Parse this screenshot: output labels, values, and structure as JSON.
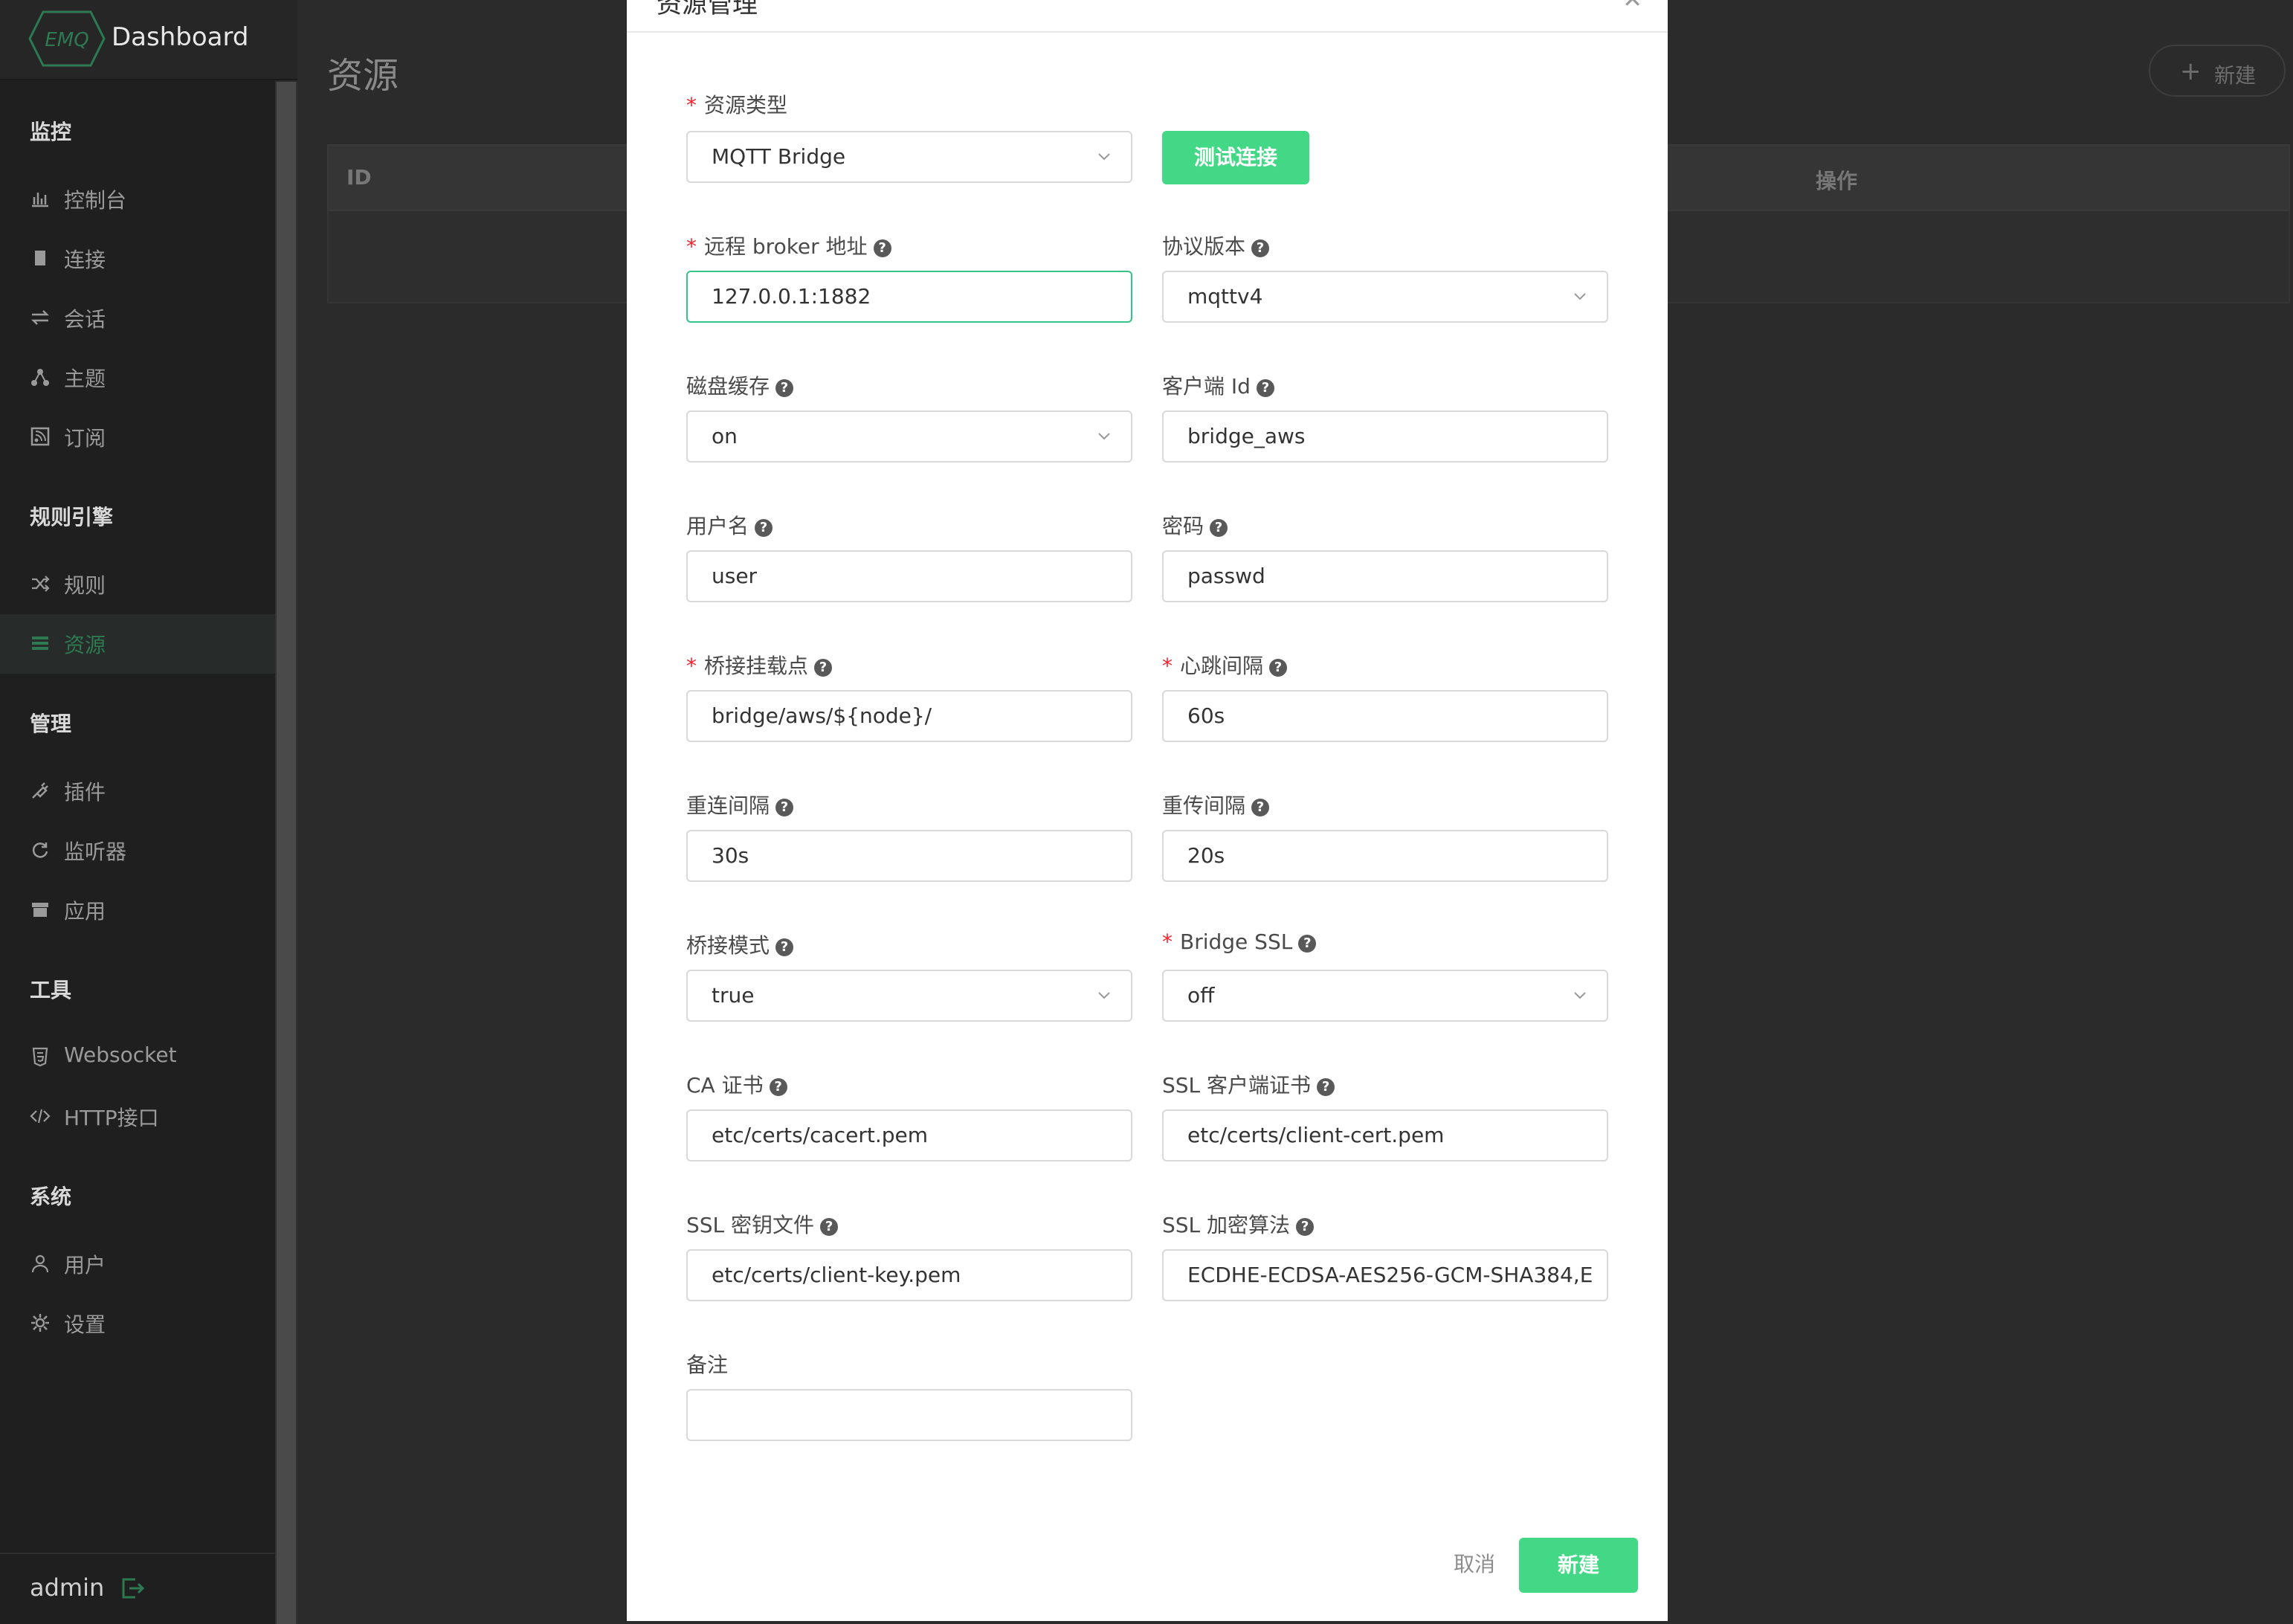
{
  "app": {
    "title": "Dashboard",
    "logo_text": "EMQ"
  },
  "sidebar": {
    "groups": [
      {
        "title": "监控",
        "items": [
          {
            "label": "控制台",
            "icon": "bar-chart-icon"
          },
          {
            "label": "连接",
            "icon": "document-icon"
          },
          {
            "label": "会话",
            "icon": "swap-icon"
          },
          {
            "label": "主题",
            "icon": "topic-icon"
          },
          {
            "label": "订阅",
            "icon": "rss-icon"
          }
        ]
      },
      {
        "title": "规则引擎",
        "items": [
          {
            "label": "规则",
            "icon": "shuffle-icon"
          },
          {
            "label": "资源",
            "icon": "list-icon",
            "active": true
          }
        ]
      },
      {
        "title": "管理",
        "items": [
          {
            "label": "插件",
            "icon": "plug-icon"
          },
          {
            "label": "监听器",
            "icon": "refresh-icon"
          },
          {
            "label": "应用",
            "icon": "archive-icon"
          }
        ]
      },
      {
        "title": "工具",
        "items": [
          {
            "label": "Websocket",
            "icon": "html5-icon"
          },
          {
            "label": "HTTP接口",
            "icon": "code-icon"
          }
        ]
      },
      {
        "title": "系统",
        "items": [
          {
            "label": "用户",
            "icon": "user-icon"
          },
          {
            "label": "设置",
            "icon": "gear-icon"
          }
        ]
      }
    ],
    "footer": {
      "user": "admin"
    }
  },
  "page": {
    "title": "资源",
    "new_button": "新建",
    "table_headers": {
      "id": "ID",
      "actions": "操作"
    }
  },
  "modal": {
    "title": "资源管理",
    "test_button": "测试连接",
    "cancel_button": "取消",
    "submit_button": "新建",
    "fields": {
      "resource_type": {
        "label": "资源类型",
        "value": "MQTT Bridge"
      },
      "broker_address": {
        "label": "远程 broker 地址",
        "value": "127.0.0.1:1882"
      },
      "protocol_version": {
        "label": "协议版本",
        "value": "mqttv4"
      },
      "disk_cache": {
        "label": "磁盘缓存",
        "value": "on"
      },
      "client_id": {
        "label": "客户端 Id",
        "value": "bridge_aws"
      },
      "username": {
        "label": "用户名",
        "value": "user"
      },
      "password": {
        "label": "密码",
        "value": "passwd"
      },
      "mountpoint": {
        "label": "桥接挂载点",
        "value": "bridge/aws/${node}/"
      },
      "keepalive": {
        "label": "心跳间隔",
        "value": "60s"
      },
      "reconnect_interval": {
        "label": "重连间隔",
        "value": "30s"
      },
      "retry_interval": {
        "label": "重传间隔",
        "value": "20s"
      },
      "bridge_mode": {
        "label": "桥接模式",
        "value": "true"
      },
      "bridge_ssl": {
        "label": "Bridge SSL",
        "value": "off"
      },
      "ca_cert": {
        "label": "CA 证书",
        "value": "etc/certs/cacert.pem"
      },
      "client_cert": {
        "label": "SSL 客户端证书",
        "value": "etc/certs/client-cert.pem"
      },
      "key_file": {
        "label": "SSL 密钥文件",
        "value": "etc/certs/client-key.pem"
      },
      "ciphers": {
        "label": "SSL 加密算法",
        "value": "ECDHE-ECDSA-AES256-GCM-SHA384,E"
      },
      "description": {
        "label": "备注",
        "value": ""
      }
    }
  },
  "colors": {
    "accent": "#42d885",
    "required": "#f5222d",
    "active_nav": "#2d7a52"
  }
}
